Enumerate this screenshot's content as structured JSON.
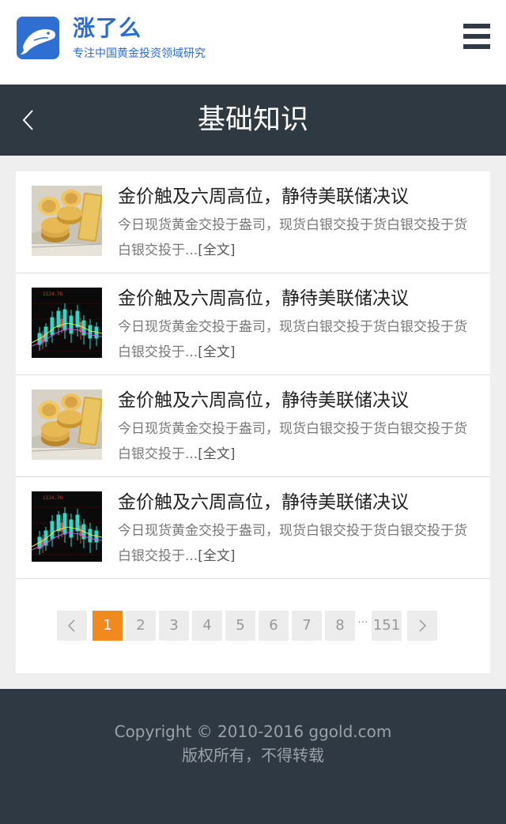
{
  "header": {
    "brand_name": "涨了么",
    "slogan": "专注中国黄金投资领域研究",
    "logo_icon": "whale-logo-icon",
    "menu_icon": "hamburger-menu-icon"
  },
  "titlebar": {
    "back_icon": "chevron-left-icon",
    "title": "基础知识"
  },
  "articles": [
    {
      "title": "金价触及六周高位，静待美联储决议",
      "summary": "今日现货黄金交投于盎司，现货白银交投于货白银交投于货白银交投于...",
      "more": "[全文]",
      "thumbnail": "gold-coins-image"
    },
    {
      "title": "金价触及六周高位，静待美联储决议",
      "summary": "今日现货黄金交投于盎司，现货白银交投于货白银交投于货白银交投于...",
      "more": "[全文]",
      "thumbnail": "candlestick-chart-image"
    },
    {
      "title": "金价触及六周高位，静待美联储决议",
      "summary": "今日现货黄金交投于盎司，现货白银交投于货白银交投于货白银交投于...",
      "more": "[全文]",
      "thumbnail": "gold-coins-image"
    },
    {
      "title": "金价触及六周高位，静待美联储决议",
      "summary": "今日现货黄金交投于盎司，现货白银交投于货白银交投于货白银交投于...",
      "more": "[全文]",
      "thumbnail": "candlestick-chart-image"
    }
  ],
  "pagination": {
    "prev_icon": "chevron-left-icon",
    "next_icon": "chevron-right-icon",
    "pages": [
      "1",
      "2",
      "3",
      "4",
      "5",
      "6",
      "7",
      "8"
    ],
    "current": "1",
    "ellipsis": "···",
    "last": "151"
  },
  "footer": {
    "copyright": "Copyright © 2010-2016 ggold.com",
    "rights": "版权所有，不得转载"
  },
  "colors": {
    "brand_blue": "#2a6bd0",
    "dark_bar": "#2f3942",
    "active_page": "#f08a1c"
  }
}
